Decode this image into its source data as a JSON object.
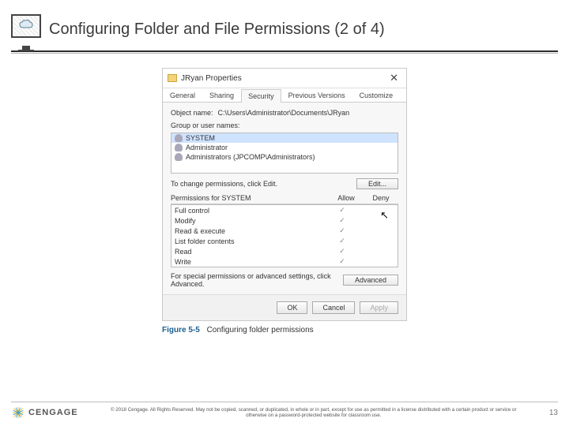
{
  "header": {
    "title": "Configuring Folder and File Permissions (2 of 4)"
  },
  "dialog": {
    "title": "JRyan Properties",
    "tabs": {
      "general": "General",
      "sharing": "Sharing",
      "security": "Security",
      "previous": "Previous Versions",
      "customize": "Customize"
    },
    "object_label": "Object name:",
    "object_value": "C:\\Users\\Administrator\\Documents\\JRyan",
    "group_label": "Group or user names:",
    "users": {
      "system": "SYSTEM",
      "admin": "Administrator",
      "admins": "Administrators (JPCOMP\\Administrators)"
    },
    "edit_hint": "To change permissions, click Edit.",
    "edit_btn": "Edit...",
    "perm_for": "Permissions for SYSTEM",
    "col_allow": "Allow",
    "col_deny": "Deny",
    "perms": {
      "full": "Full control",
      "modify": "Modify",
      "readex": "Read & execute",
      "list": "List folder contents",
      "read": "Read",
      "write": "Write"
    },
    "check": "✓",
    "adv_hint": "For special permissions or advanced settings, click Advanced.",
    "adv_btn": "Advanced",
    "ok": "OK",
    "cancel": "Cancel",
    "apply": "Apply"
  },
  "caption": {
    "label": "Figure 5-5",
    "text": "Configuring folder permissions"
  },
  "footer": {
    "brand": "CENGAGE",
    "copyright": "© 2018 Cengage. All Rights Reserved. May not be copied, scanned, or duplicated, in whole or in part, except for use as permitted in a license distributed with a certain product or service or otherwise on a password-protected website for classroom use.",
    "page": "13"
  }
}
